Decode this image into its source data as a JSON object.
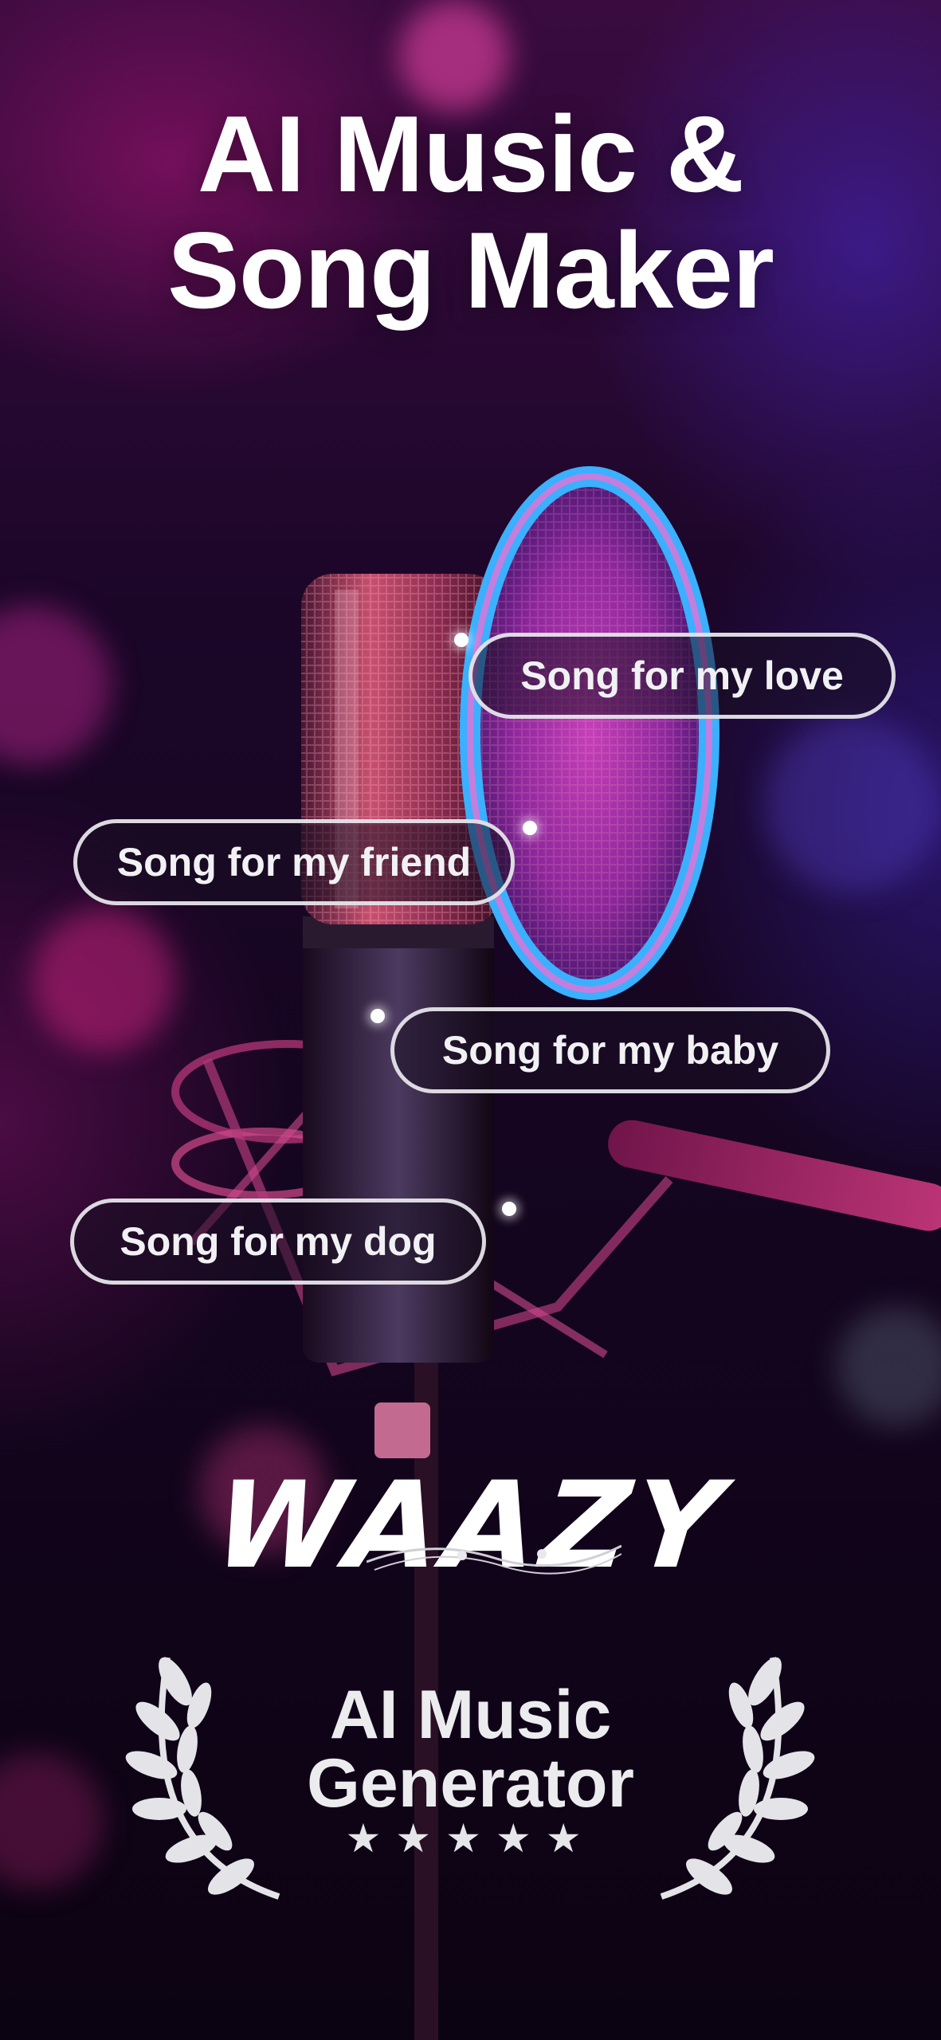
{
  "headline": {
    "line1": "AI Music &",
    "line2": "Song Maker"
  },
  "prompts": [
    {
      "label": "Song for my love"
    },
    {
      "label": "Song for my friend"
    },
    {
      "label": "Song for my baby"
    },
    {
      "label": "Song for my dog"
    }
  ],
  "brand": {
    "logo_text": "WAAZY"
  },
  "award": {
    "line1": "AI Music",
    "line2": "Generator",
    "stars": "★★★★★",
    "rating": 5
  },
  "colors": {
    "accent_magenta": "#e0359a",
    "accent_blue": "#3aa0ff",
    "background": "#14051f"
  }
}
